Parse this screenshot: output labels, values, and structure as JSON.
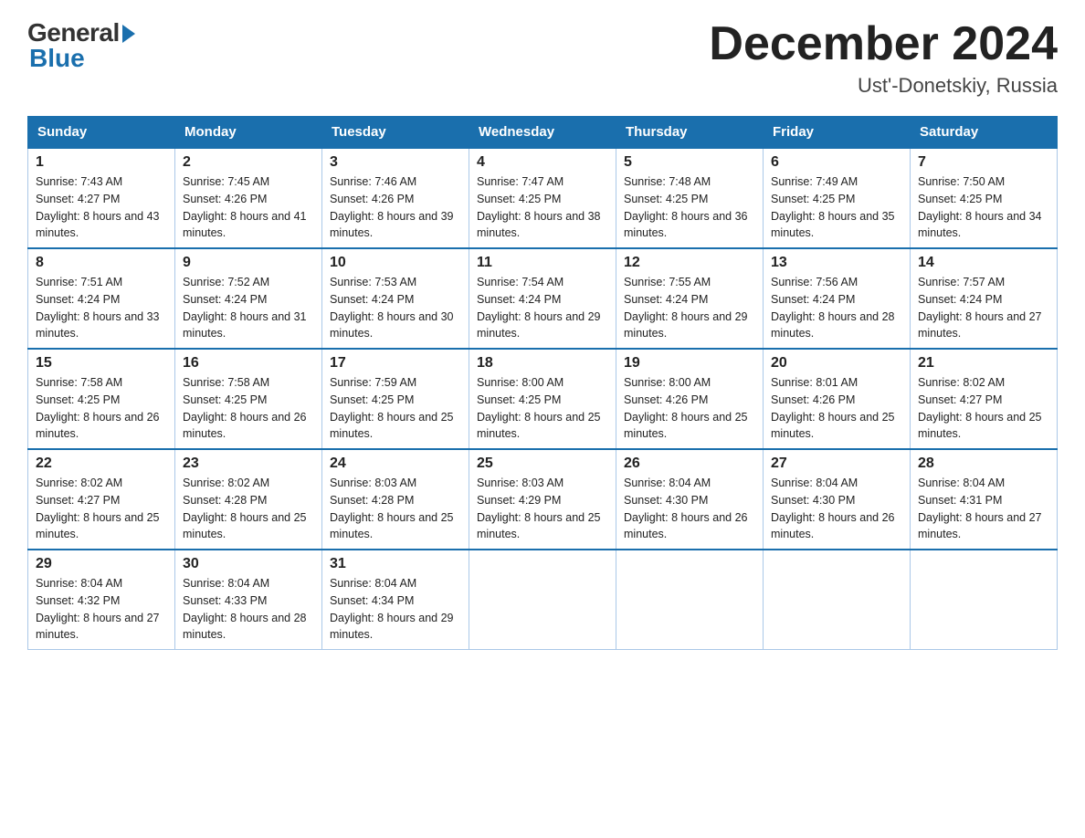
{
  "header": {
    "logo_general": "General",
    "logo_blue": "Blue",
    "title": "December 2024",
    "subtitle": "Ust'-Donetskiy, Russia"
  },
  "days_of_week": [
    "Sunday",
    "Monday",
    "Tuesday",
    "Wednesday",
    "Thursday",
    "Friday",
    "Saturday"
  ],
  "weeks": [
    [
      {
        "day": "1",
        "sunrise": "7:43 AM",
        "sunset": "4:27 PM",
        "daylight": "8 hours and 43 minutes."
      },
      {
        "day": "2",
        "sunrise": "7:45 AM",
        "sunset": "4:26 PM",
        "daylight": "8 hours and 41 minutes."
      },
      {
        "day": "3",
        "sunrise": "7:46 AM",
        "sunset": "4:26 PM",
        "daylight": "8 hours and 39 minutes."
      },
      {
        "day": "4",
        "sunrise": "7:47 AM",
        "sunset": "4:25 PM",
        "daylight": "8 hours and 38 minutes."
      },
      {
        "day": "5",
        "sunrise": "7:48 AM",
        "sunset": "4:25 PM",
        "daylight": "8 hours and 36 minutes."
      },
      {
        "day": "6",
        "sunrise": "7:49 AM",
        "sunset": "4:25 PM",
        "daylight": "8 hours and 35 minutes."
      },
      {
        "day": "7",
        "sunrise": "7:50 AM",
        "sunset": "4:25 PM",
        "daylight": "8 hours and 34 minutes."
      }
    ],
    [
      {
        "day": "8",
        "sunrise": "7:51 AM",
        "sunset": "4:24 PM",
        "daylight": "8 hours and 33 minutes."
      },
      {
        "day": "9",
        "sunrise": "7:52 AM",
        "sunset": "4:24 PM",
        "daylight": "8 hours and 31 minutes."
      },
      {
        "day": "10",
        "sunrise": "7:53 AM",
        "sunset": "4:24 PM",
        "daylight": "8 hours and 30 minutes."
      },
      {
        "day": "11",
        "sunrise": "7:54 AM",
        "sunset": "4:24 PM",
        "daylight": "8 hours and 29 minutes."
      },
      {
        "day": "12",
        "sunrise": "7:55 AM",
        "sunset": "4:24 PM",
        "daylight": "8 hours and 29 minutes."
      },
      {
        "day": "13",
        "sunrise": "7:56 AM",
        "sunset": "4:24 PM",
        "daylight": "8 hours and 28 minutes."
      },
      {
        "day": "14",
        "sunrise": "7:57 AM",
        "sunset": "4:24 PM",
        "daylight": "8 hours and 27 minutes."
      }
    ],
    [
      {
        "day": "15",
        "sunrise": "7:58 AM",
        "sunset": "4:25 PM",
        "daylight": "8 hours and 26 minutes."
      },
      {
        "day": "16",
        "sunrise": "7:58 AM",
        "sunset": "4:25 PM",
        "daylight": "8 hours and 26 minutes."
      },
      {
        "day": "17",
        "sunrise": "7:59 AM",
        "sunset": "4:25 PM",
        "daylight": "8 hours and 25 minutes."
      },
      {
        "day": "18",
        "sunrise": "8:00 AM",
        "sunset": "4:25 PM",
        "daylight": "8 hours and 25 minutes."
      },
      {
        "day": "19",
        "sunrise": "8:00 AM",
        "sunset": "4:26 PM",
        "daylight": "8 hours and 25 minutes."
      },
      {
        "day": "20",
        "sunrise": "8:01 AM",
        "sunset": "4:26 PM",
        "daylight": "8 hours and 25 minutes."
      },
      {
        "day": "21",
        "sunrise": "8:02 AM",
        "sunset": "4:27 PM",
        "daylight": "8 hours and 25 minutes."
      }
    ],
    [
      {
        "day": "22",
        "sunrise": "8:02 AM",
        "sunset": "4:27 PM",
        "daylight": "8 hours and 25 minutes."
      },
      {
        "day": "23",
        "sunrise": "8:02 AM",
        "sunset": "4:28 PM",
        "daylight": "8 hours and 25 minutes."
      },
      {
        "day": "24",
        "sunrise": "8:03 AM",
        "sunset": "4:28 PM",
        "daylight": "8 hours and 25 minutes."
      },
      {
        "day": "25",
        "sunrise": "8:03 AM",
        "sunset": "4:29 PM",
        "daylight": "8 hours and 25 minutes."
      },
      {
        "day": "26",
        "sunrise": "8:04 AM",
        "sunset": "4:30 PM",
        "daylight": "8 hours and 26 minutes."
      },
      {
        "day": "27",
        "sunrise": "8:04 AM",
        "sunset": "4:30 PM",
        "daylight": "8 hours and 26 minutes."
      },
      {
        "day": "28",
        "sunrise": "8:04 AM",
        "sunset": "4:31 PM",
        "daylight": "8 hours and 27 minutes."
      }
    ],
    [
      {
        "day": "29",
        "sunrise": "8:04 AM",
        "sunset": "4:32 PM",
        "daylight": "8 hours and 27 minutes."
      },
      {
        "day": "30",
        "sunrise": "8:04 AM",
        "sunset": "4:33 PM",
        "daylight": "8 hours and 28 minutes."
      },
      {
        "day": "31",
        "sunrise": "8:04 AM",
        "sunset": "4:34 PM",
        "daylight": "8 hours and 29 minutes."
      },
      null,
      null,
      null,
      null
    ]
  ]
}
